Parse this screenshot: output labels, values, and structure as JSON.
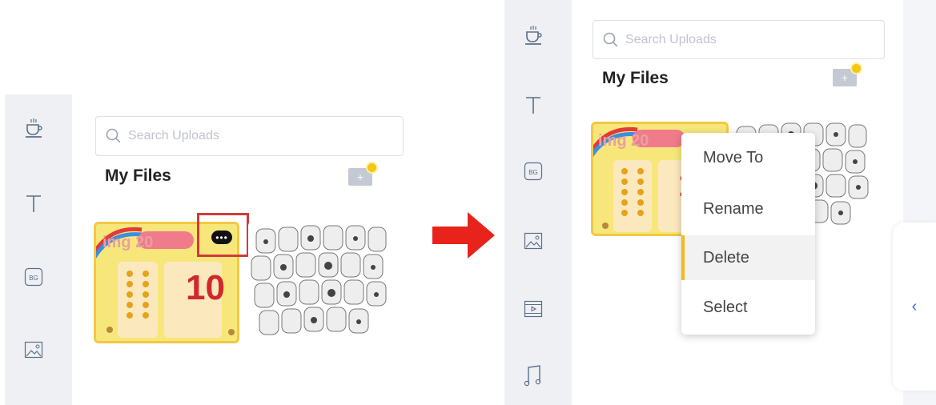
{
  "before": {
    "search": {
      "placeholder": "Search Uploads"
    },
    "title": "My Files",
    "add_label": "+",
    "thumb_label": "img 20",
    "more_label": "•••",
    "game_number": "10"
  },
  "after": {
    "search": {
      "placeholder": "Search Uploads"
    },
    "title": "My Files",
    "add_label": "+",
    "thumb_label": "img 20",
    "game_number": "10",
    "context_menu": {
      "items": [
        {
          "label": "Move To"
        },
        {
          "label": "Rename"
        },
        {
          "label": "Delete"
        },
        {
          "label": "Select"
        }
      ],
      "highlighted": "Delete"
    },
    "collapse_label": "‹"
  },
  "rail_left": [
    "coffee-icon",
    "text-icon",
    "background-icon",
    "image-icon"
  ],
  "rail_right": [
    "coffee-icon",
    "text-icon",
    "background-icon",
    "image-icon",
    "video-icon",
    "music-icon"
  ],
  "arrow": {
    "color": "#e8231c"
  },
  "colors": {
    "accent": "#f5b91b",
    "highlight": "#d03a3a",
    "rail": "#eef0f4"
  }
}
